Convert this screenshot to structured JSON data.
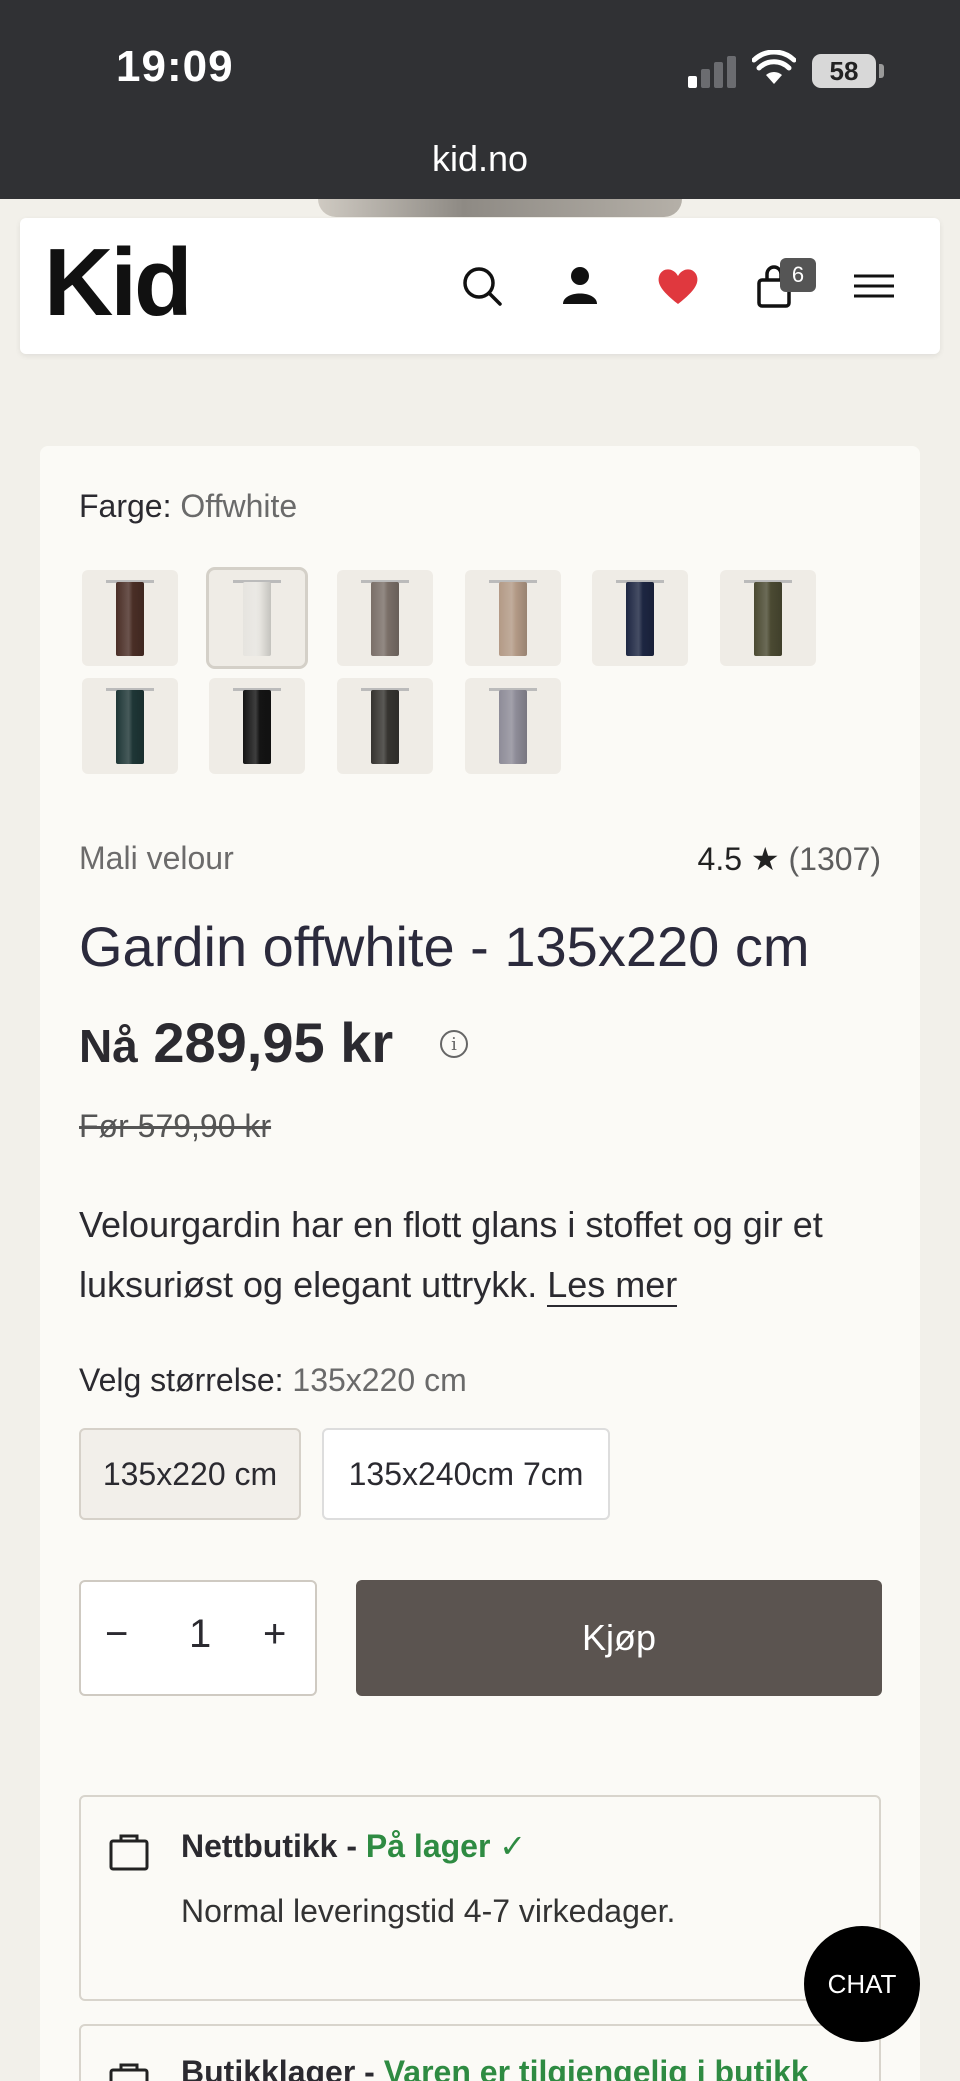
{
  "status_bar": {
    "time": "19:09",
    "battery": "58",
    "url": "kid.no"
  },
  "header": {
    "logo": "Kid",
    "cart_count": "6",
    "icons": [
      "search-icon",
      "account-icon",
      "heart-icon",
      "cart-icon",
      "menu-icon"
    ],
    "accent_heart": "#e0383e"
  },
  "color_picker": {
    "label": "Farge:",
    "value": "Offwhite",
    "swatches": [
      {
        "name": "Brown",
        "color": "#4a2e26"
      },
      {
        "name": "Offwhite",
        "color": "#e6e4df",
        "selected": true
      },
      {
        "name": "Grey",
        "color": "#7a6f68"
      },
      {
        "name": "Beige",
        "color": "#b39a86"
      },
      {
        "name": "Navy",
        "color": "#1d2642"
      },
      {
        "name": "Olive",
        "color": "#4b4a32"
      },
      {
        "name": "Dark green",
        "color": "#1e3636"
      },
      {
        "name": "Black",
        "color": "#141414"
      },
      {
        "name": "Charcoal",
        "color": "#363430"
      },
      {
        "name": "Lilac grey",
        "color": "#8e8c98"
      }
    ]
  },
  "product": {
    "brand": "Mali velour",
    "rating": "4.5",
    "rating_star": "★",
    "review_count": "(1307)",
    "title": "Gardin offwhite - 135x220 cm",
    "price_prefix": "Nå",
    "price": "289,95 kr",
    "old_price": "Før 579,90 kr",
    "description": "Velourgardin har en flott glans i stoffet og gir et luksuriøst og elegant uttrykk.",
    "read_more": "Les mer"
  },
  "size_picker": {
    "label": "Velg størrelse:",
    "value": "135x220 cm",
    "options": [
      "135x220 cm",
      "135x240cm 7cm"
    ]
  },
  "purchase": {
    "minus": "−",
    "quantity": "1",
    "plus": "+",
    "buy_label": "Kjøp"
  },
  "availability": {
    "online_label": "Nettbutikk -",
    "online_status": "På lager",
    "online_check": "✓",
    "online_note": "Normal leveringstid 4-7 virkedager.",
    "store_label": "Butikklager -",
    "store_status": "Varen er tilgjengelig i butikk"
  },
  "chat": {
    "label": "CHAT"
  }
}
